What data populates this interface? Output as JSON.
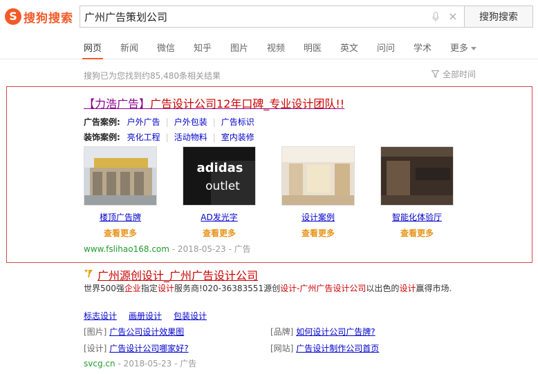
{
  "header": {
    "logo_text": "搜狗搜索",
    "search_value": "广州广告策划公司",
    "search_button": "搜狗搜索",
    "mic_icon": "microphone-icon",
    "clear_icon": "×"
  },
  "nav": {
    "items": [
      "网页",
      "新闻",
      "微信",
      "知乎",
      "图片",
      "视频",
      "明医",
      "英文",
      "问问",
      "学术",
      "更多"
    ],
    "active": "网页"
  },
  "results_info": {
    "count_text": "搜狗已为您找到约85,480条相关结果",
    "time_filter": "全部时间"
  },
  "ad": {
    "title_bracket": "【力浩广告】",
    "title_rest": "广告设计公司12年口碑_专业设计团队!!",
    "row1_label": "广告案例:",
    "row1_links": [
      "户外广告",
      "户外包装",
      "广告标识"
    ],
    "row2_label": "装饰案例:",
    "row2_links": [
      "亮化工程",
      "活动物料",
      "室内装修"
    ],
    "thumbs": [
      {
        "caption": "楼顶广告牌",
        "more": "查看更多"
      },
      {
        "caption": "AD发光字",
        "more": "查看更多",
        "img_text_1": "adidas",
        "img_text_2": "outlet"
      },
      {
        "caption": "设计案例",
        "more": "查看更多"
      },
      {
        "caption": "智能化体验厅",
        "more": "查看更多"
      }
    ],
    "url_host": "www.fslihao168.com",
    "url_meta": " - 2018-05-23 - 广告"
  },
  "organic": {
    "title": "广州源创设计_广州广告设计公司",
    "snippet_parts": [
      {
        "t": "世界500强",
        "hl": false
      },
      {
        "t": "企业",
        "hl": true
      },
      {
        "t": "指定",
        "hl": false
      },
      {
        "t": "设计",
        "hl": true
      },
      {
        "t": "服务商!020-36383551源创",
        "hl": false
      },
      {
        "t": "设计-广州广告设计公司",
        "hl": true
      },
      {
        "t": "以出色的",
        "hl": false
      },
      {
        "t": "设计",
        "hl": true
      },
      {
        "t": "赢得市场.",
        "hl": false
      }
    ],
    "links": [
      "标志设计",
      "画册设计",
      "包装设计"
    ],
    "sublinks": [
      {
        "tag": "[图片]",
        "text": "广告公司设计效果图"
      },
      {
        "tag": "[品牌]",
        "text": "如何设计公司广告牌?"
      },
      {
        "tag": "[设计]",
        "text": "广告设计公司哪家好?"
      },
      {
        "tag": "[网站]",
        "text": "广告设计制作公司首页"
      }
    ],
    "url_host": "svcg.cn",
    "url_meta": " - 2018-05-23 - 广告"
  },
  "colors": {
    "brand": "#f25a29",
    "ad_border": "#d5474b",
    "link": "#0000cc",
    "url_green": "#219b2e",
    "more_orange": "#e8941a"
  }
}
